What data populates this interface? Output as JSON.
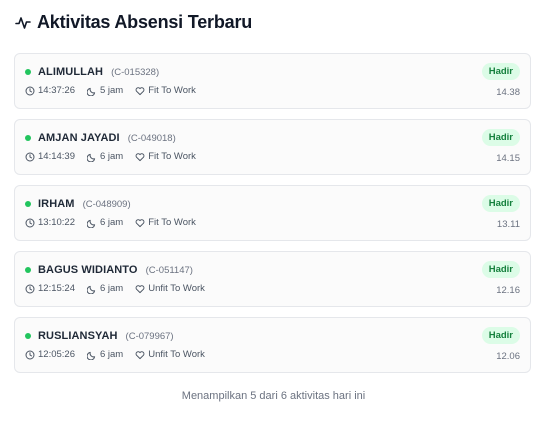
{
  "header": {
    "title": "Aktivitas Absensi Terbaru",
    "icon": "activity-icon"
  },
  "colors": {
    "status_dot": "#22c55e",
    "badge_bg": "#dcfce7",
    "badge_text": "#15803d"
  },
  "items": [
    {
      "name": "ALIMULLAH",
      "code": "(C-015328)",
      "clock": "14:37:26",
      "duration": "5 jam",
      "status": "Fit To Work",
      "badge": "Hadir",
      "time": "14.38"
    },
    {
      "name": "AMJAN JAYADI",
      "code": "(C-049018)",
      "clock": "14:14:39",
      "duration": "6 jam",
      "status": "Fit To Work",
      "badge": "Hadir",
      "time": "14.15"
    },
    {
      "name": "IRHAM",
      "code": "(C-048909)",
      "clock": "13:10:22",
      "duration": "6 jam",
      "status": "Fit To Work",
      "badge": "Hadir",
      "time": "13.11"
    },
    {
      "name": "BAGUS WIDIANTO",
      "code": "(C-051147)",
      "clock": "12:15:24",
      "duration": "6 jam",
      "status": "Unfit To Work",
      "badge": "Hadir",
      "time": "12.16"
    },
    {
      "name": "RUSLIANSYAH",
      "code": "(C-079967)",
      "clock": "12:05:26",
      "duration": "6 jam",
      "status": "Unfit To Work",
      "badge": "Hadir",
      "time": "12.06"
    }
  ],
  "footer": {
    "text": "Menampilkan 5 dari 6 aktivitas hari ini"
  }
}
